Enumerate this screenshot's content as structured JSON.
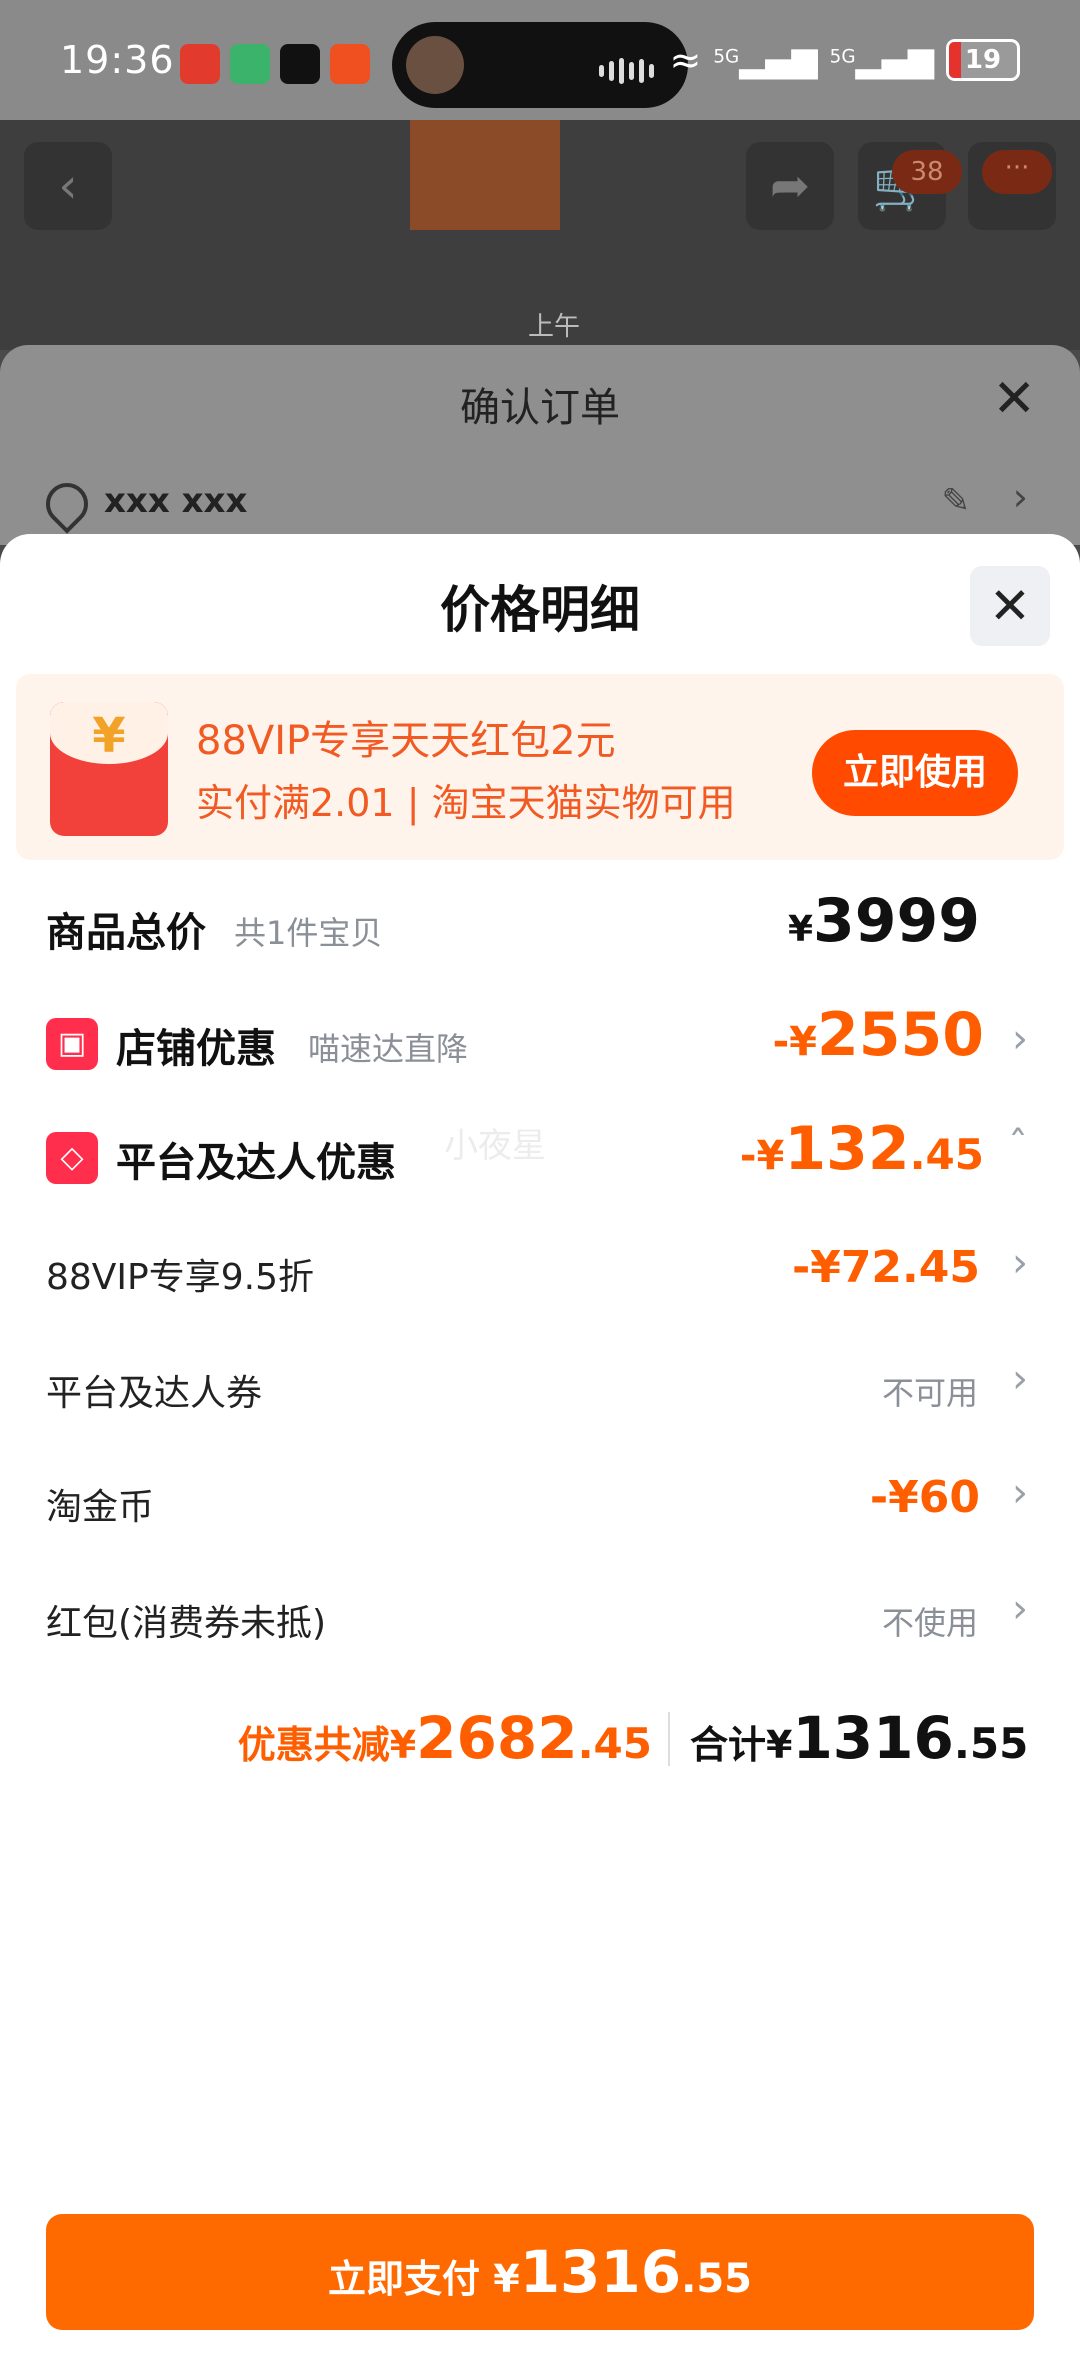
{
  "status_bar": {
    "time": "19:36",
    "network_1": "5G",
    "network_2": "5G",
    "battery": "19"
  },
  "background_page": {
    "cart_count": "38",
    "more_label": "···",
    "watch_label": "上午"
  },
  "confirm_order": {
    "title": "确认订单",
    "address": "xxx xxx"
  },
  "price_detail": {
    "title": "价格明细",
    "promo": {
      "line1": "88VIP专享天天红包2元",
      "line2": "实付满2.01 | 淘宝天猫实物可用",
      "button": "立即使用"
    },
    "total": {
      "title": "商品总价",
      "subtitle": "共1件宝贝",
      "currency": "¥",
      "amount": "3999"
    },
    "store_discount": {
      "title": "店铺优惠",
      "subtitle": "喵速达直降",
      "prefix": "-¥",
      "amount": "2550"
    },
    "platform_discount": {
      "title": "平台及达人优惠",
      "prefix": "-¥",
      "amount_int": "132",
      "amount_dec": ".45"
    },
    "watermark": "小夜星",
    "items": [
      {
        "label": "88VIP专享9.5折",
        "value": "-¥72.45"
      },
      {
        "label": "平台及达人券",
        "value": "不可用"
      },
      {
        "label": "淘金币",
        "value": "-¥60"
      },
      {
        "label": "红包(消费券未抵)",
        "value": "不使用"
      }
    ],
    "summary": {
      "discount_label": "优惠共减¥",
      "discount_int": "2682",
      "discount_dec": ".45",
      "total_label": "合计¥",
      "total_int": "1316",
      "total_dec": ".55"
    },
    "pay_button": {
      "label": "立即支付 ¥",
      "amount_int": "1316",
      "amount_dec": ".55"
    }
  },
  "colors": {
    "accent": "#ff6a00",
    "discount": "#ff5e00",
    "promo_bg": "#fff4ec"
  }
}
